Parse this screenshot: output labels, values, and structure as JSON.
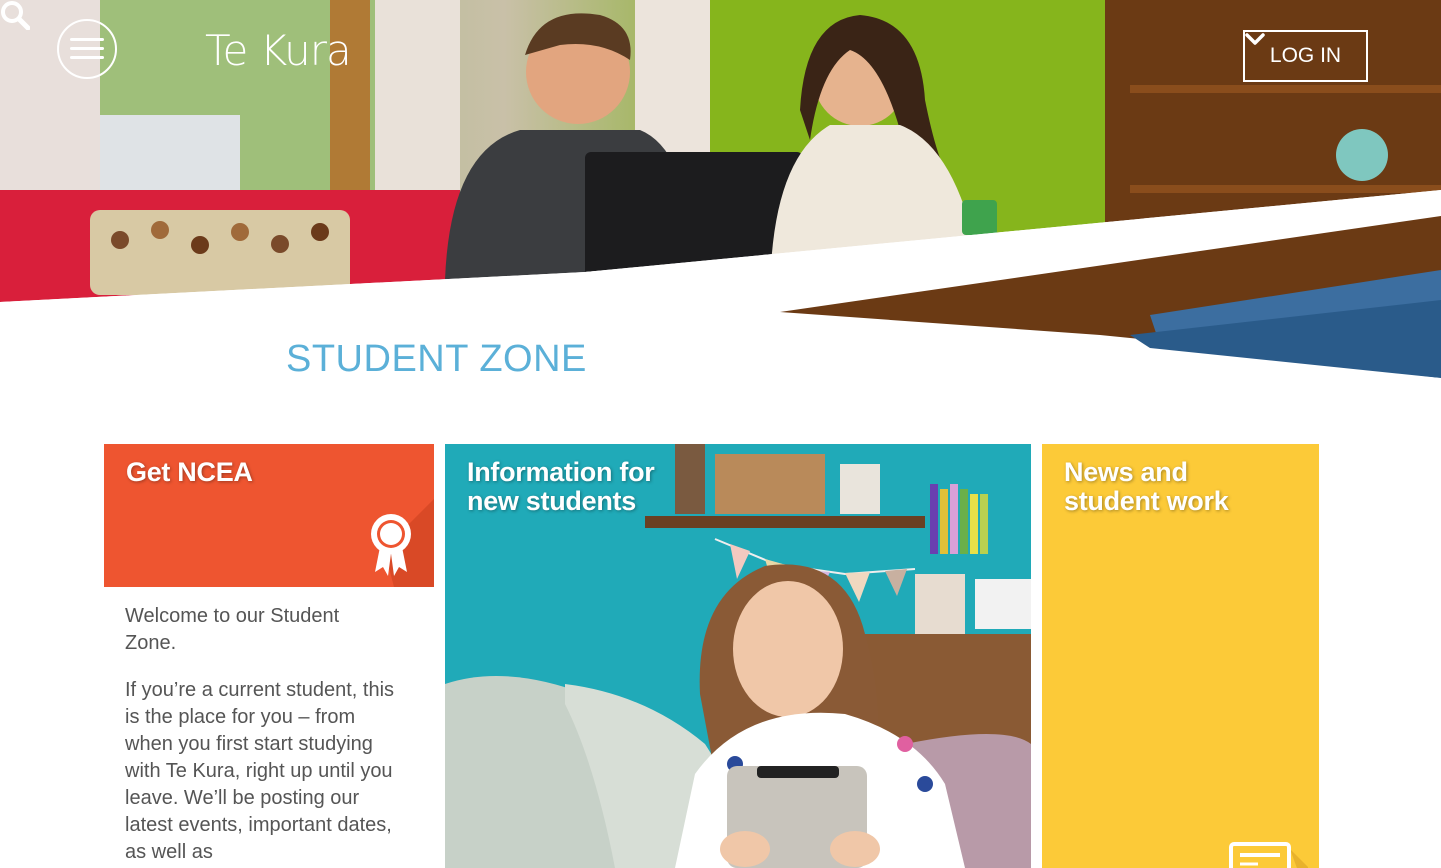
{
  "header": {
    "logo_text": "Te Kura",
    "menu_icon": "hamburger-menu-icon",
    "search_icon": "search-icon",
    "login_label": "LOG IN",
    "login_icon": "chevron-down-icon"
  },
  "main": {
    "title": "STUDENT ZONE",
    "intro_paragraphs": [
      "Welcome to our Student Zone.",
      "If you’re a current student, this is the place for you – from when you first start studying with Te Kura, right up until you leave. We’ll be posting our latest events, important dates, as well as"
    ]
  },
  "tiles": [
    {
      "title": "Get NCEA",
      "color": "#ee5530",
      "icon": "award-ribbon-icon"
    },
    {
      "title": "Information for new students",
      "color": "#1fa9b8",
      "icon": ""
    },
    {
      "title": "News and student work",
      "color": "#fcca38",
      "icon": "newspaper-icon"
    }
  ],
  "colors": {
    "accent_title": "#5bb0d8",
    "body_text": "#555555"
  }
}
